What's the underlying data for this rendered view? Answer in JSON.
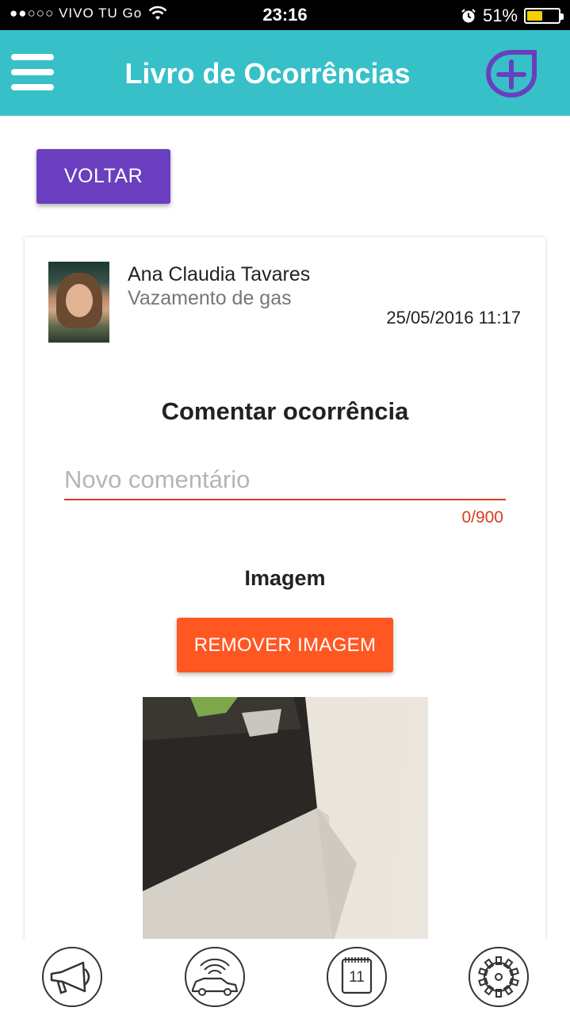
{
  "status_bar": {
    "carrier": "●●○○○ VIVO TU Go",
    "time": "23:16",
    "battery_percent": "51%",
    "battery_level": 0.51,
    "battery_color": "#f5d000"
  },
  "header": {
    "title": "Livro de Ocorrências",
    "menu_icon": "hamburger-menu-icon",
    "add_icon": "plus-circle-icon",
    "bg_color": "#37c0c8",
    "accent_color": "#6a3fbf"
  },
  "back_button": {
    "label": "VOLTAR",
    "color": "#6a3fbf"
  },
  "occurrence": {
    "author": "Ana Claudia Tavares",
    "title": "Vazamento de gas",
    "datetime": "25/05/2016 11:17"
  },
  "comment_form": {
    "heading": "Comentar ocorrência",
    "input_value": "",
    "input_placeholder": "Novo comentário",
    "counter": "0/900",
    "error_color": "#d83c1d",
    "image_heading": "Imagem",
    "remove_image_label": "REMOVER IMAGEM",
    "remove_button_color": "#ff5722"
  },
  "bottom_nav": {
    "items": [
      {
        "icon": "megaphone-icon"
      },
      {
        "icon": "car-signal-icon"
      },
      {
        "icon": "calendar-icon",
        "label": "11"
      },
      {
        "icon": "gear-icon"
      }
    ]
  }
}
